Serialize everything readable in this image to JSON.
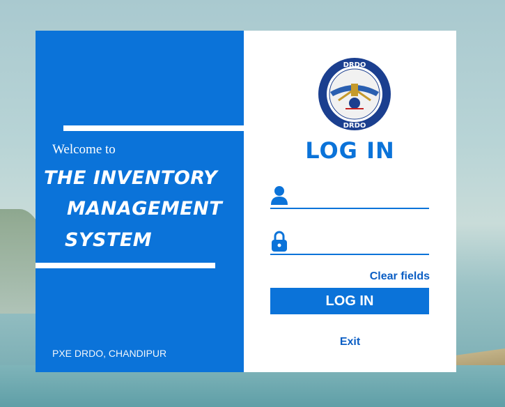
{
  "left_panel": {
    "welcome": "Welcome to",
    "title_line1": "THE INVENTORY",
    "title_line2": "MANAGEMENT",
    "title_line3": "SYSTEM",
    "footer": "PXE DRDO, CHANDIPUR"
  },
  "right_panel": {
    "logo_text": "DRDO",
    "heading": "LOG IN",
    "username": {
      "value": "",
      "placeholder": "",
      "icon": "user-icon"
    },
    "password": {
      "value": "",
      "placeholder": "",
      "icon": "lock-icon"
    },
    "clear_label": "Clear fields",
    "login_label": "LOG IN",
    "exit_label": "Exit"
  },
  "colors": {
    "accent": "#0b73d9",
    "link": "#0b5ec4",
    "logo_ring": "#1b3f8f"
  }
}
